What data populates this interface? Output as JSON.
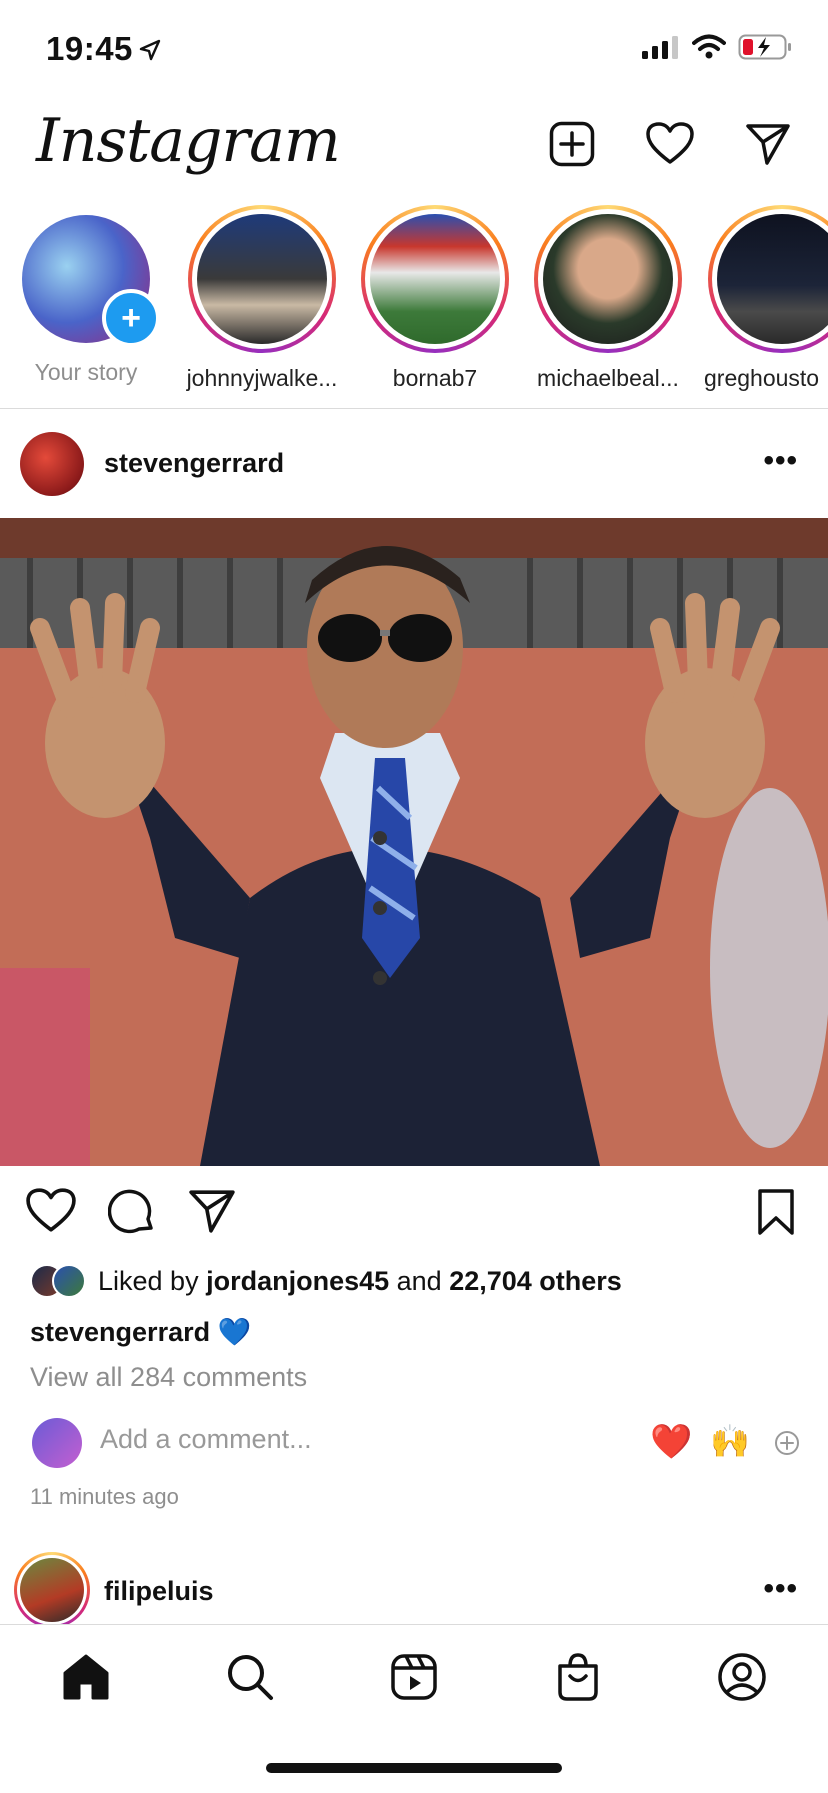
{
  "status": {
    "time": "19:45"
  },
  "app": {
    "logo": "Instagram"
  },
  "stories": [
    {
      "label": "Your story"
    },
    {
      "label": "johnnyjwalke..."
    },
    {
      "label": "bornab7"
    },
    {
      "label": "michaelbeal..."
    },
    {
      "label": "greghousto"
    }
  ],
  "post": {
    "username": "stevengerrard",
    "liked_prefix": "Liked by ",
    "liked_user": "jordanjones45",
    "liked_and": " and ",
    "liked_others": "22,704 others",
    "caption_user": "stevengerrard",
    "caption_text": "💙",
    "view_comments": "View all 284 comments",
    "comment_placeholder": "Add a comment...",
    "quick_emoji_1": "❤️",
    "quick_emoji_2": "🙌",
    "timestamp": "11 minutes ago"
  },
  "next_post": {
    "username": "filipeluis"
  },
  "colors": {
    "accent": "#1d9bf0",
    "story_ring": "#d62976",
    "muted": "#8e8e8e",
    "battery_low": "#e0112b"
  },
  "tabs": [
    "home-icon",
    "search-icon",
    "reels-icon",
    "shop-icon",
    "profile-icon"
  ]
}
